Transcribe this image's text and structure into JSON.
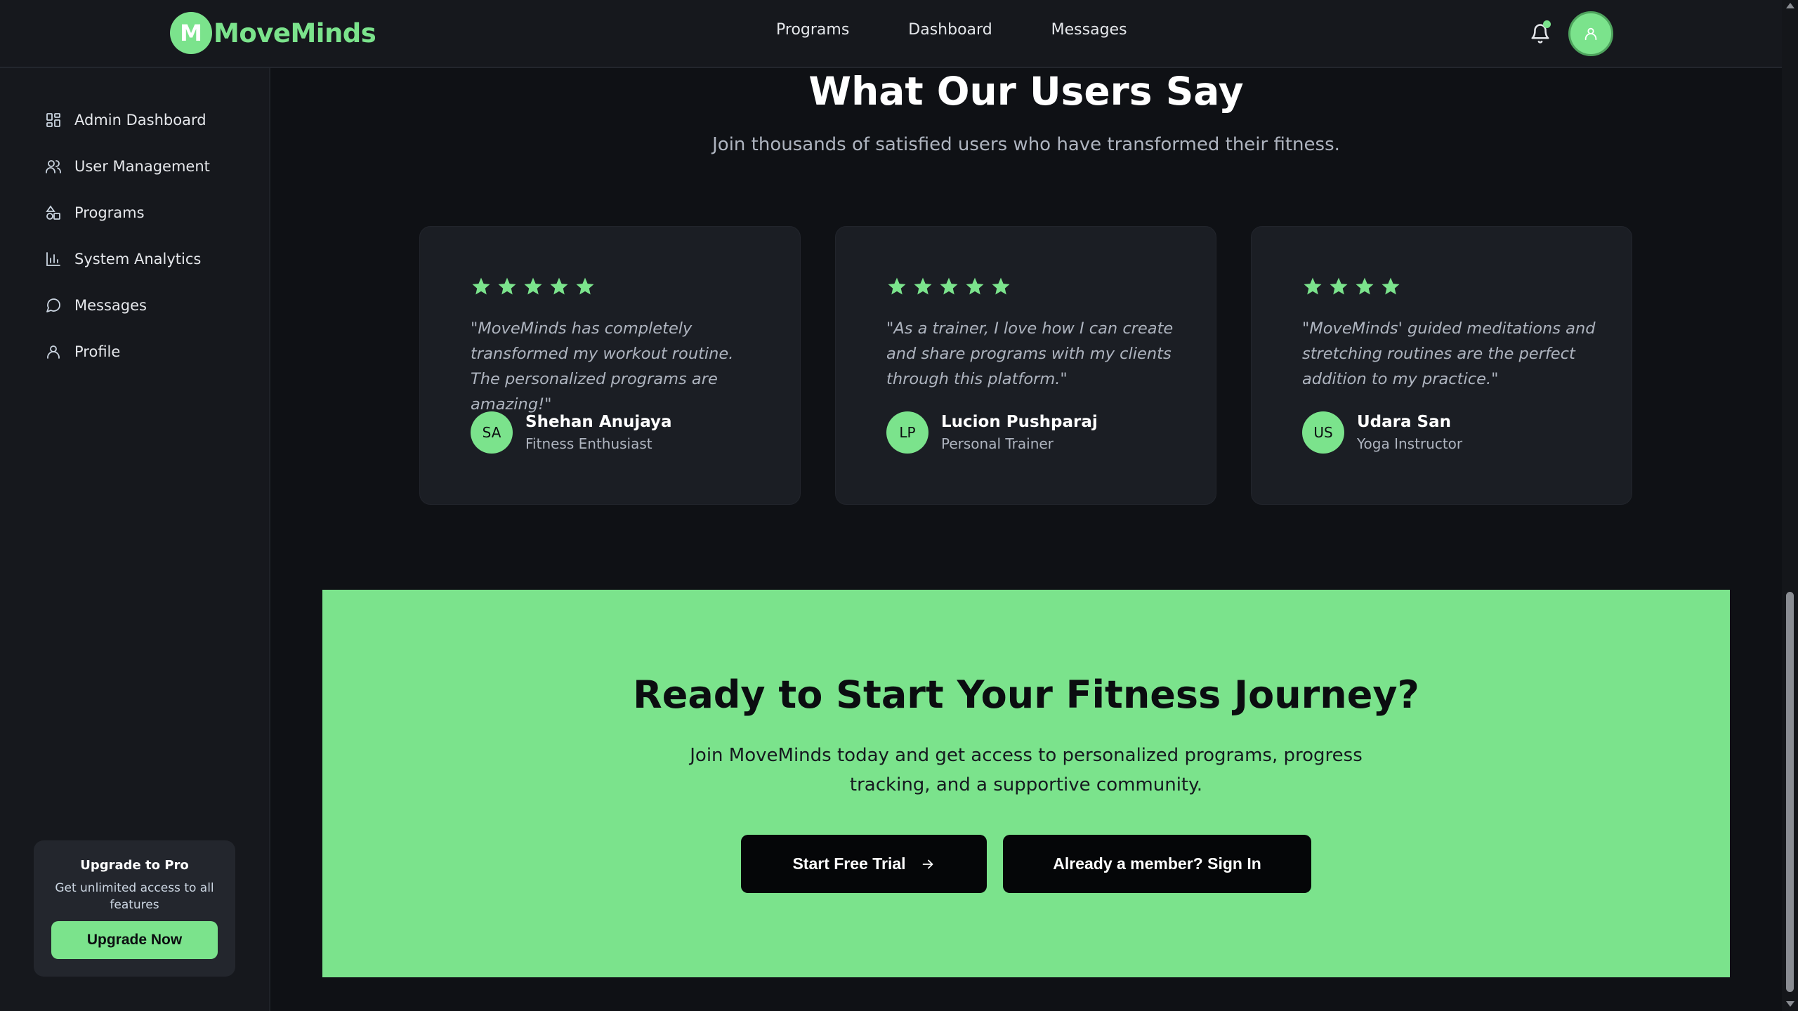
{
  "brand": {
    "initial": "M",
    "name": "MoveMinds",
    "accent_color": "#7be38c"
  },
  "topnav": {
    "items": [
      "Programs",
      "Dashboard",
      "Messages"
    ]
  },
  "header_icons": {
    "bell": "bell-icon",
    "avatar": "user-icon"
  },
  "sidebar": {
    "items": [
      {
        "label": "Admin Dashboard",
        "icon": "dashboard-grid-icon"
      },
      {
        "label": "User Management",
        "icon": "users-icon"
      },
      {
        "label": "Programs",
        "icon": "shapes-icon"
      },
      {
        "label": "System Analytics",
        "icon": "bar-chart-icon"
      },
      {
        "label": "Messages",
        "icon": "message-circle-icon"
      },
      {
        "label": "Profile",
        "icon": "user-icon"
      }
    ],
    "upgrade": {
      "title": "Upgrade to Pro",
      "description": "Get unlimited access to all features",
      "button": "Upgrade Now"
    }
  },
  "testimonials": {
    "heading": "What Our Users Say",
    "subheading": "Join thousands of satisfied users who have transformed their fitness.",
    "cards": [
      {
        "stars": 5,
        "quote": "\"MoveMinds has completely transformed my workout routine. The personalized programs are amazing!\"",
        "initials": "SA",
        "name": "Shehan Anujaya",
        "role": "Fitness Enthusiast"
      },
      {
        "stars": 5,
        "quote": "\"As a trainer, I love how I can create and share programs with my clients through this platform.\"",
        "initials": "LP",
        "name": "Lucion Pushparaj",
        "role": "Personal Trainer"
      },
      {
        "stars": 4,
        "quote": "\"MoveMinds' guided meditations and stretching routines are the perfect addition to my practice.\"",
        "initials": "US",
        "name": "Udara San",
        "role": "Yoga Instructor"
      }
    ]
  },
  "cta": {
    "title": "Ready to Start Your Fitness Journey?",
    "description": "Join MoveMinds today and get access to personalized programs, progress tracking, and a supportive community.",
    "primary_button": "Start Free Trial",
    "secondary_button": "Already a member? Sign In"
  }
}
